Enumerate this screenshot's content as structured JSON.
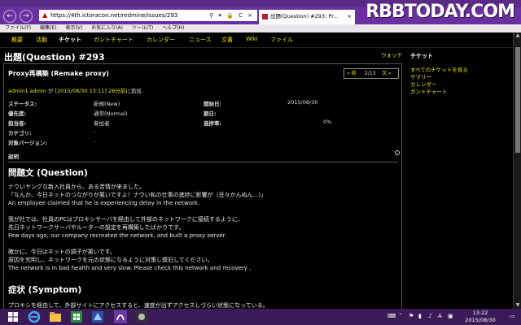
{
  "browser": {
    "url": "https://4th.ictoracon.net/redmine/issues/293",
    "tab_title": "出題(Question) #293: Pr...",
    "menu": [
      "ファイル(F)",
      "編集(E)",
      "表示(V)",
      "お気に入り(A)",
      "ツール(T)",
      "ヘルプ(H)"
    ],
    "back_glyph": "←",
    "forward_glyph": "→",
    "address_tools": "⚲ ▾ 🔒 C ×",
    "tab_close": "×"
  },
  "watermark": "RBBTODAY.COM",
  "top_menu": [
    {
      "label": "概要"
    },
    {
      "label": "活動"
    },
    {
      "label": "チケット",
      "active": true
    },
    {
      "label": "ガントチャート"
    },
    {
      "label": "カレンダー"
    },
    {
      "label": "ニュース"
    },
    {
      "label": "文書"
    },
    {
      "label": "Wiki"
    },
    {
      "label": "ファイル"
    }
  ],
  "issue": {
    "header": "出題(Question) #293",
    "watch": "ウォッチ",
    "subject": "Proxy再構築 (Remake proxy)",
    "nav": {
      "prev": "« 前",
      "position": "2/13",
      "next": "次 »"
    },
    "author": {
      "name": "admin1 admin",
      "mid": " が ",
      "date": "[2015/08/30 13:11]",
      "ago": " 28分前",
      "suffix": "に追加."
    },
    "attributes": {
      "status": {
        "label": "ステータス:",
        "value": "新規(New)"
      },
      "priority": {
        "label": "優先度:",
        "value": "通常(Normal)"
      },
      "assignee": {
        "label": "担当者:",
        "value": "参加者"
      },
      "category": {
        "label": "カテゴリ:",
        "value": "-"
      },
      "version": {
        "label": "対象バージョン:",
        "value": "-"
      },
      "start_date": {
        "label": "開始日:",
        "value": "2015/08/30"
      },
      "due_date": {
        "label": "期日:",
        "value": ""
      },
      "progress": {
        "label": "進捗率:",
        "value": "0%"
      }
    },
    "description_label": "説明",
    "sections": [
      {
        "heading": "問題文 (Question)",
        "paragraphs": [
          [
            "ナウいヤングな新入社員から、ある苦情が来ました。",
            "「なんか、今日ネットのつながりが悪いですよ！ナウい私の仕事の進捗に影響が（豆々かんぬん...)」",
            "An employee claimed that he is experiencing delay in the network."
          ],
          [
            "我が社では、社員のPCはプロキシサーバを経由して外部のネットワークに接続するように、",
            "先日ネットワークサーバやルーターの設定を再構築したばかりです。",
            "Few days ago, our company recreated the network, and built a proxy server."
          ],
          [
            "確かに、今日はネットの調子が悪いです。",
            "原因を究明し、ネットワークを元の状態になるように対策し復旧してください。",
            "The network is in bad health and very slow. Please check this network and recovery ."
          ]
        ]
      },
      {
        "heading": "症状 (Symptom)",
        "paragraphs": [
          [
            "プロキシを経由して、外部サイトにアクセスすると、速度が出ずアクセスしづらい状態になっている。"
          ]
        ]
      }
    ]
  },
  "sidebar": {
    "title": "チケット",
    "links": [
      "すべてのチケットを見る",
      "サマリー",
      "カレンダー",
      "ガントチャート"
    ]
  },
  "taskbar": {
    "time": "13:22",
    "date": "2015/08/30"
  },
  "colors": {
    "link": "#e6e600",
    "chrome": "#6a2fa0",
    "taskbar": "#3a1b58"
  }
}
